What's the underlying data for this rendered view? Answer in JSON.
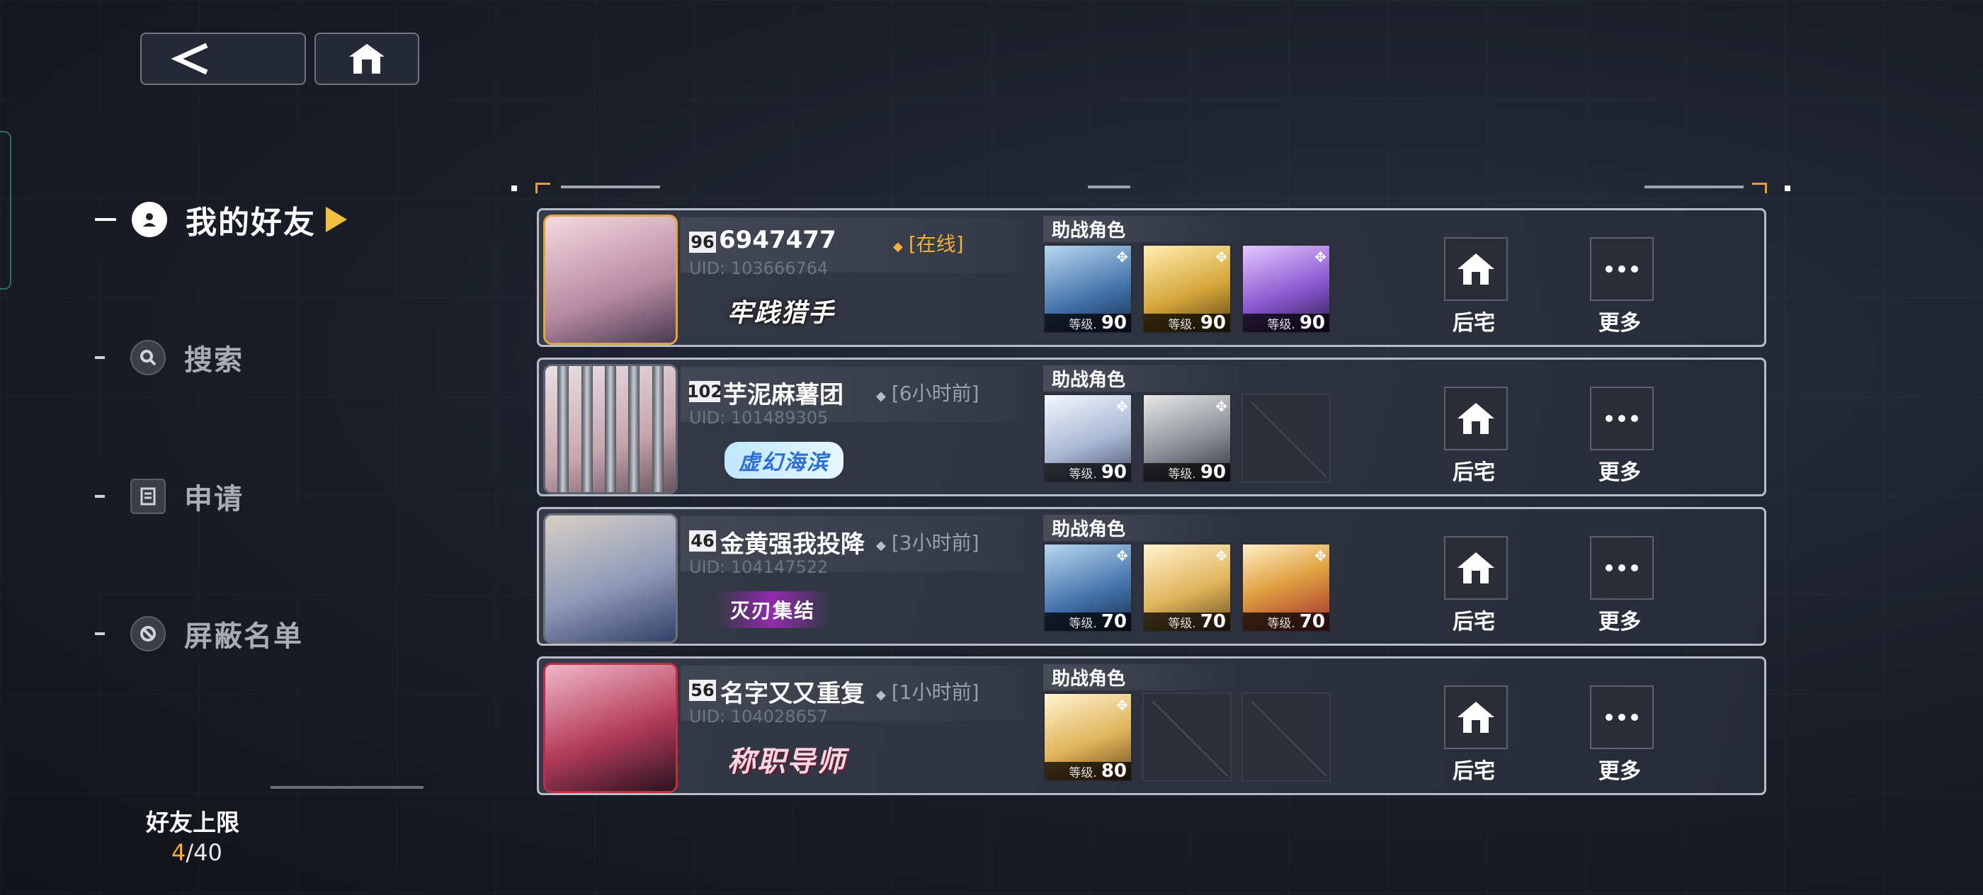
{
  "nav": {
    "items": [
      {
        "label": "我的好友",
        "icon": "user-icon",
        "active": true
      },
      {
        "label": "搜索",
        "icon": "search-icon",
        "active": false
      },
      {
        "label": "申请",
        "icon": "list-icon",
        "active": false
      },
      {
        "label": "屏蔽名单",
        "icon": "block-icon",
        "active": false
      }
    ]
  },
  "limit": {
    "title": "好友上限",
    "current": "4",
    "max": "/40"
  },
  "labels": {
    "support": "助战角色",
    "dorm": "后宅",
    "more": "更多",
    "level_prefix": "等级."
  },
  "friends": [
    {
      "level": "96",
      "name": "6947477",
      "uid": "UID: 103666764",
      "status": "[在线]",
      "online": true,
      "title": "牢践猎手",
      "support": [
        {
          "level": "90",
          "color": "blue"
        },
        {
          "level": "90",
          "color": "gold"
        },
        {
          "level": "90",
          "color": "purple"
        }
      ]
    },
    {
      "level": "102",
      "name": "芋泥麻薯团",
      "uid": "UID: 101489305",
      "status": "[6小时前]",
      "online": false,
      "title": "虚幻海滨",
      "support": [
        {
          "level": "90",
          "color": "white"
        },
        {
          "level": "90",
          "color": "gray"
        },
        null
      ]
    },
    {
      "level": "46",
      "name": "金黄强我投降",
      "uid": "UID: 104147522",
      "status": "[3小时前]",
      "online": false,
      "title": "灭刃集结",
      "support": [
        {
          "level": "70",
          "color": "blue"
        },
        {
          "level": "70",
          "color": "blonde"
        },
        {
          "level": "70",
          "color": "red"
        }
      ]
    },
    {
      "level": "56",
      "name": "名字又又重复",
      "uid": "UID: 104028657",
      "status": "[1小时前]",
      "online": false,
      "title": "称职导师",
      "support": [
        {
          "level": "80",
          "color": "blonde"
        },
        null,
        null
      ]
    }
  ]
}
